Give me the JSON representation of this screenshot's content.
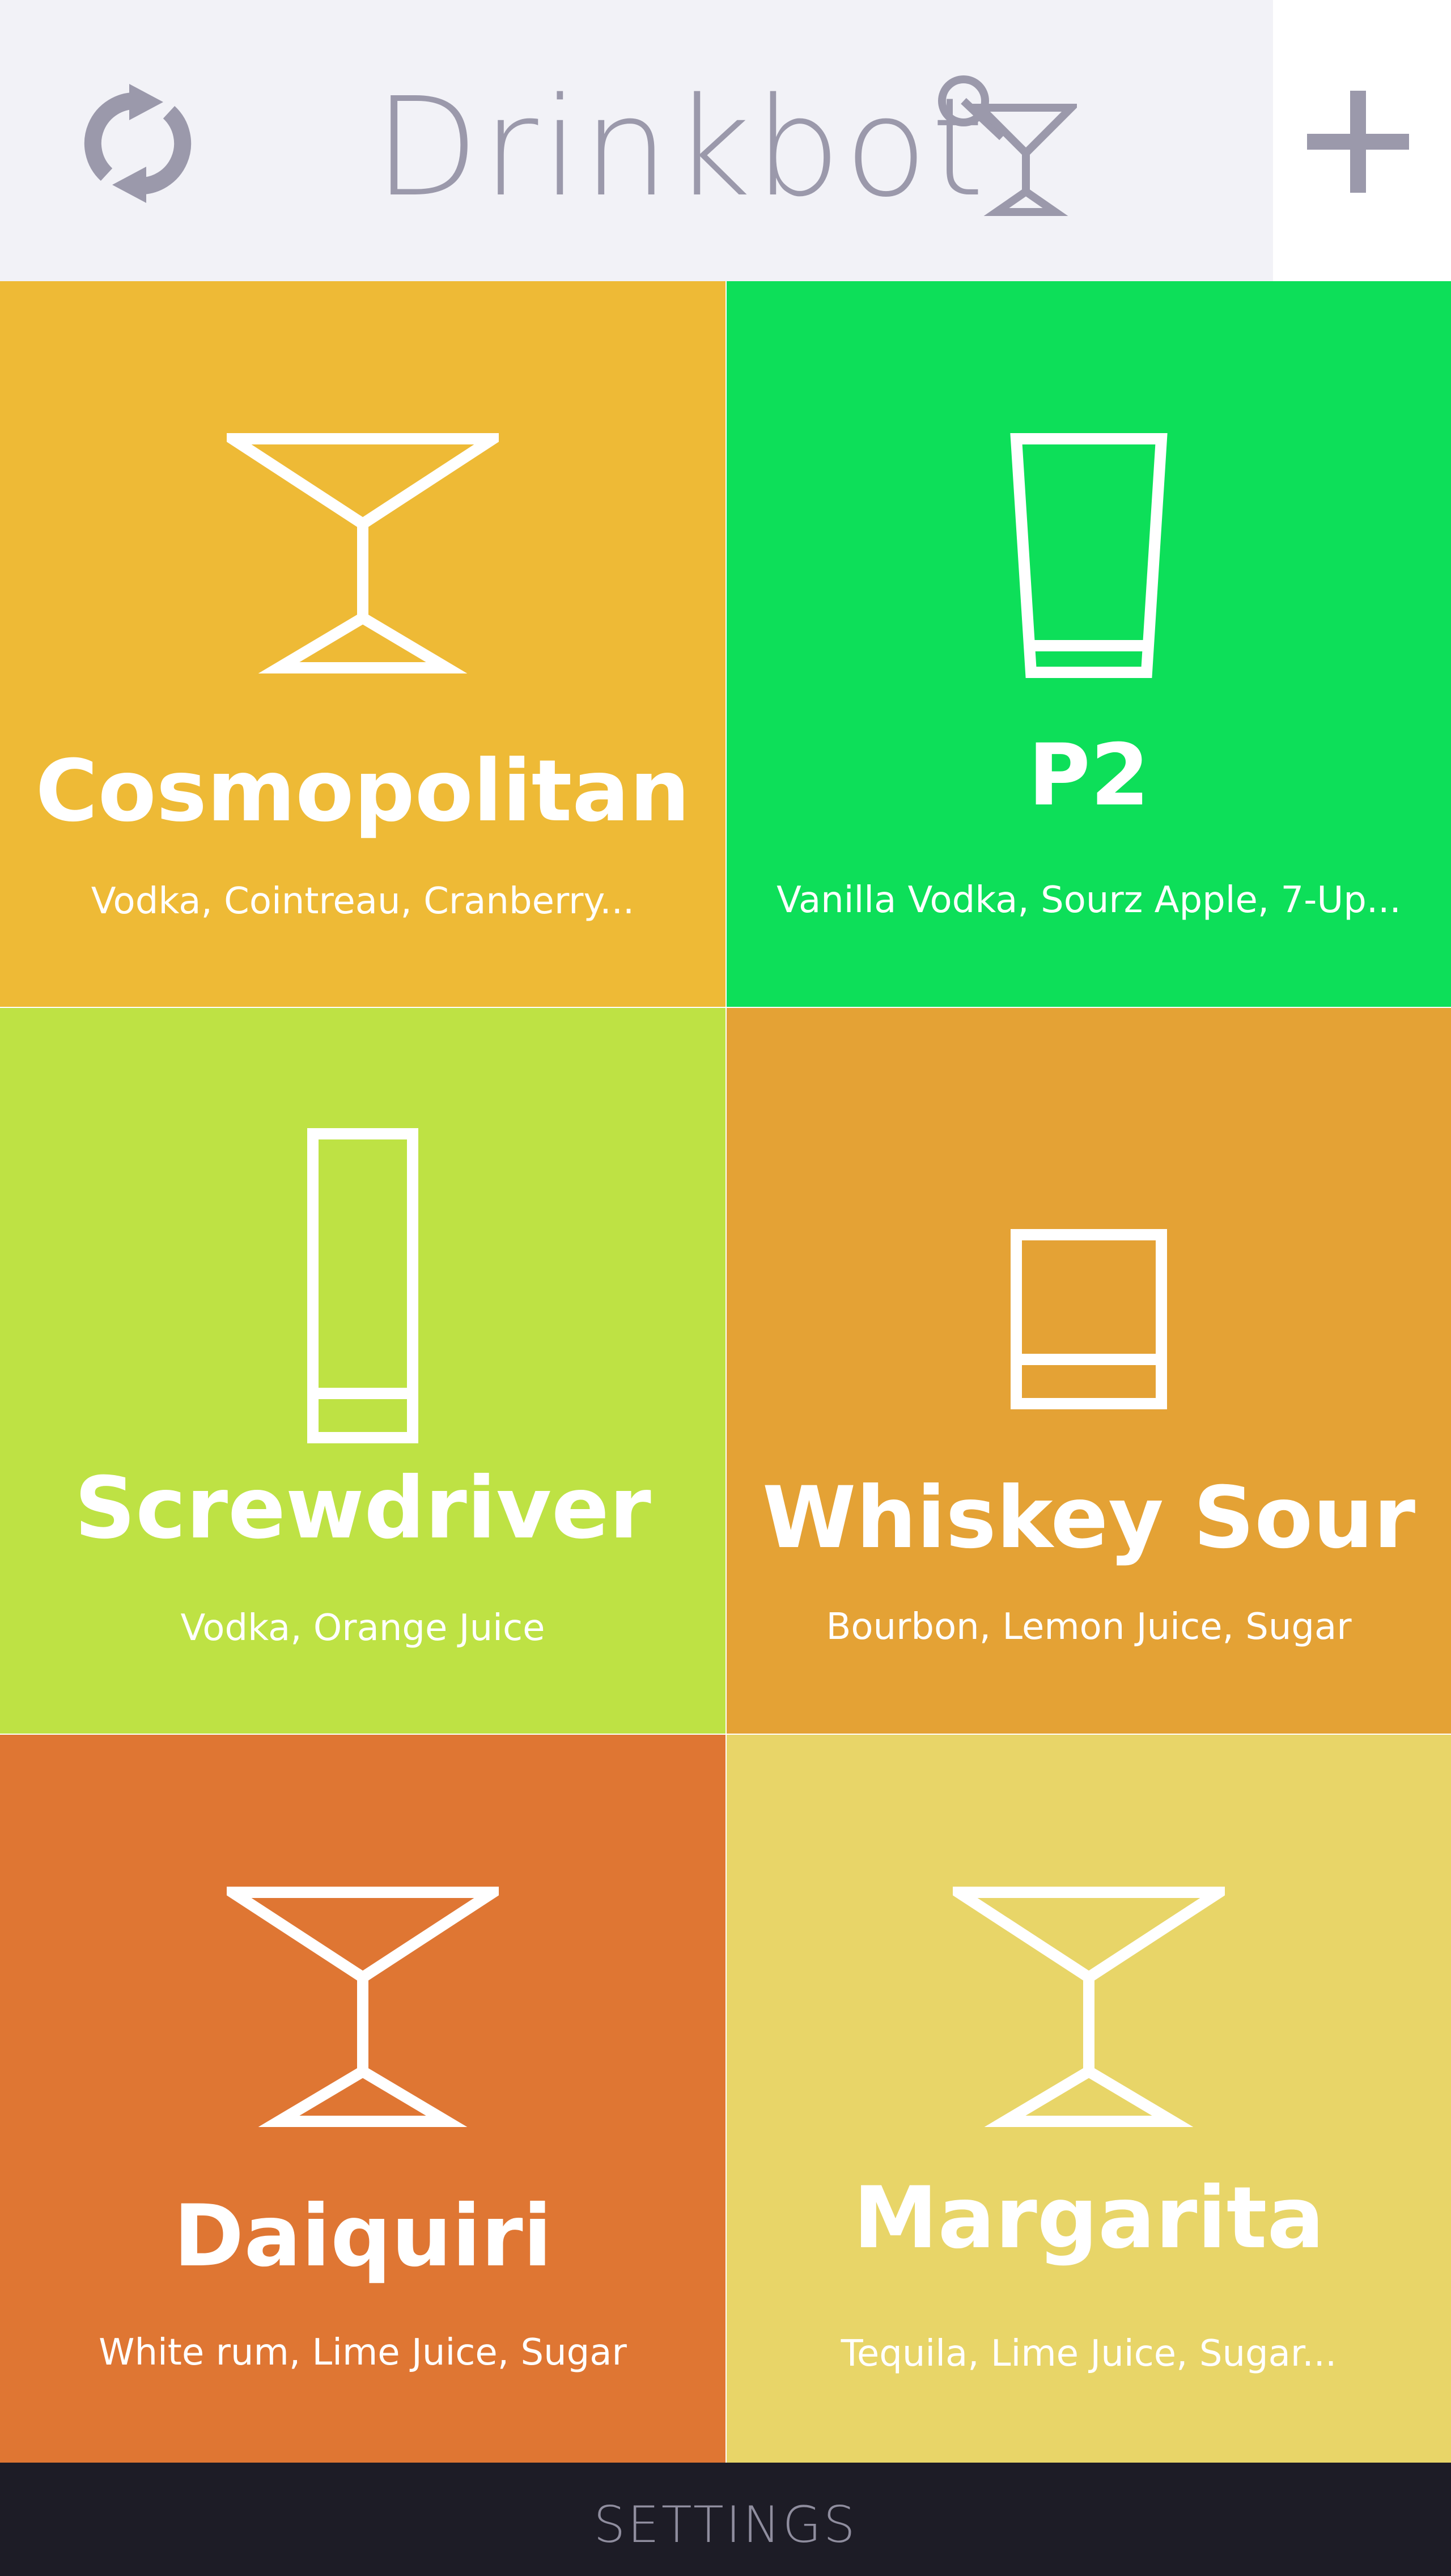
{
  "header": {
    "title": "Drinkbot",
    "refresh_icon": "refresh-icon",
    "logo_icon": "cocktail-glass-icon",
    "add_icon": "plus-icon",
    "background": "#f2f2f7",
    "text_color": "#9b99ab"
  },
  "drinks": [
    {
      "name": "Cosmopolitan",
      "ingredients": "Vodka, Cointreau, Cranberry...",
      "glass": "martini-glass-icon",
      "color": "#eeba36"
    },
    {
      "name": "P2",
      "ingredients": "Vanilla Vodka, Sourz Apple, 7-Up...",
      "glass": "pint-glass-icon",
      "color": "#0ddf59"
    },
    {
      "name": "Screwdriver",
      "ingredients": "Vodka, Orange Juice",
      "glass": "highball-glass-icon",
      "color": "#bee244"
    },
    {
      "name": "Whiskey Sour",
      "ingredients": "Bourbon, Lemon Juice, Sugar",
      "glass": "rocks-glass-icon",
      "color": "#e4a235"
    },
    {
      "name": "Daiquiri",
      "ingredients": "White rum, Lime Juice, Sugar",
      "glass": "martini-glass-icon",
      "color": "#df7633"
    },
    {
      "name": "Margarita",
      "ingredients": "Tequila, Lime Juice, Sugar...",
      "glass": "martini-glass-icon",
      "color": "#e8d568"
    }
  ],
  "footer": {
    "settings_label": "SETTINGS",
    "background": "#1d1c26"
  }
}
